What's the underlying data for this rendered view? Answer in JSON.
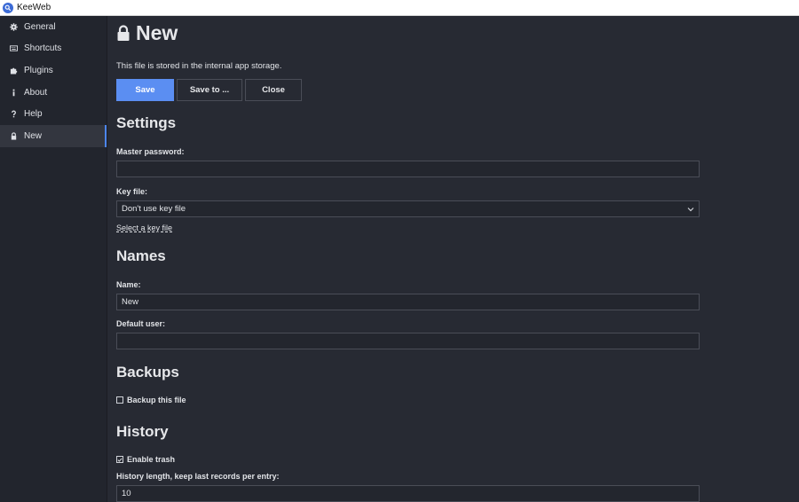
{
  "window": {
    "title": "KeeWeb"
  },
  "sidebar": {
    "items": [
      {
        "label": "General",
        "icon": "gear-icon"
      },
      {
        "label": "Shortcuts",
        "icon": "keyboard-icon"
      },
      {
        "label": "Plugins",
        "icon": "puzzle-icon"
      },
      {
        "label": "About",
        "icon": "info-icon"
      },
      {
        "label": "Help",
        "icon": "question-icon"
      },
      {
        "label": "New",
        "icon": "lock-icon",
        "active": true
      }
    ]
  },
  "main": {
    "title": "New",
    "info": "This file is stored in the internal app storage.",
    "buttons": {
      "save": "Save",
      "save_to": "Save to ...",
      "close": "Close"
    },
    "settings": {
      "heading": "Settings",
      "master_password_label": "Master password:",
      "master_password_value": "",
      "key_file_label": "Key file:",
      "key_file_value": "Don't use key file",
      "select_key_file_link": "Select a key file"
    },
    "names": {
      "heading": "Names",
      "name_label": "Name:",
      "name_value": "New",
      "default_user_label": "Default user:",
      "default_user_value": ""
    },
    "backups": {
      "heading": "Backups",
      "backup_label": "Backup this file",
      "backup_checked": false
    },
    "history": {
      "heading": "History",
      "enable_trash_label": "Enable trash",
      "enable_trash_checked": true,
      "history_length_label": "History length, keep last records per entry:",
      "history_length_value": "10"
    }
  },
  "colors": {
    "accent": "#5b8ef2",
    "background": "#272a33",
    "sidebar": "#22252d"
  }
}
